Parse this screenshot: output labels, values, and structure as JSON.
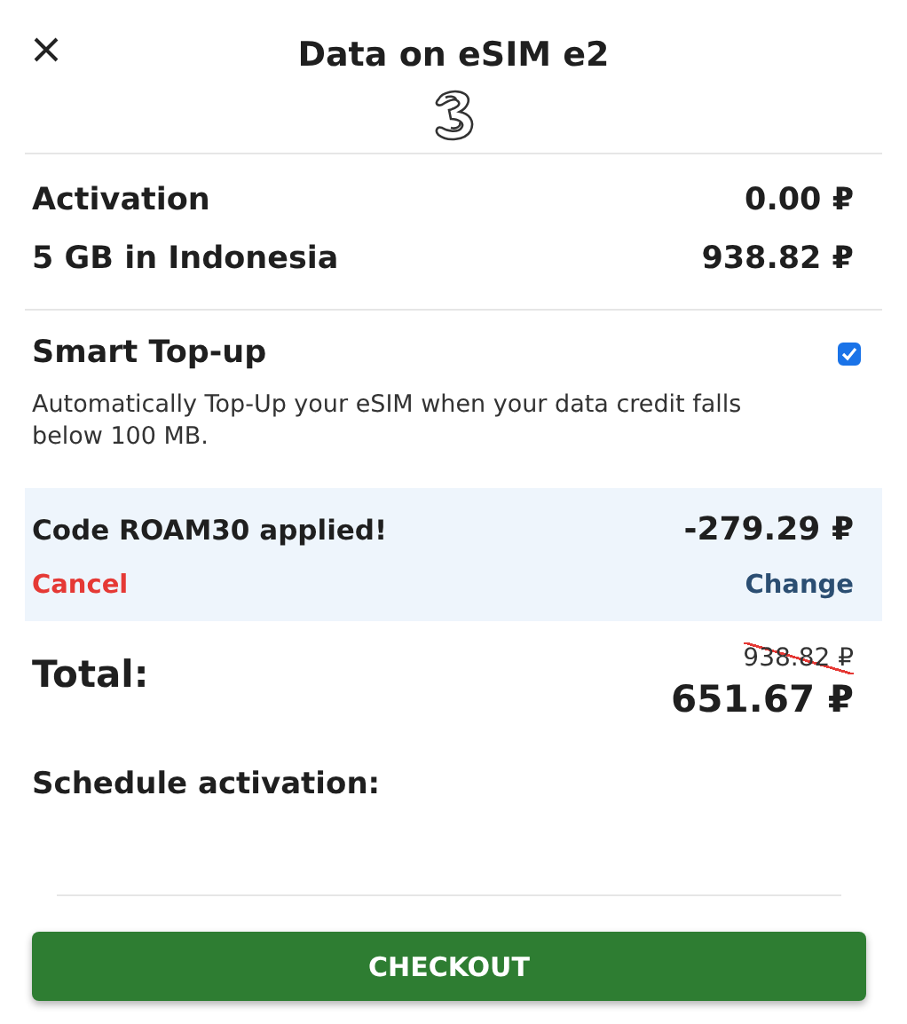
{
  "header": {
    "title": "Data on eSIM e2"
  },
  "items": [
    {
      "label": "Activation",
      "price": "0.00 ₽"
    },
    {
      "label": "5 GB in Indonesia",
      "price": "938.82 ₽"
    }
  ],
  "smart_topup": {
    "title": "Smart Top-up",
    "checked": true,
    "description": "Automatically Top-Up your eSIM when your data credit falls below 100 MB."
  },
  "promo": {
    "message": "Code ROAM30 applied!",
    "discount": "-279.29 ₽",
    "cancel": "Cancel",
    "change": "Change"
  },
  "total": {
    "label": "Total:",
    "old_price": "938.82 ₽",
    "price": "651.67 ₽"
  },
  "schedule": {
    "label": "Schedule activation:"
  },
  "checkout": {
    "label": "CHECKOUT"
  }
}
